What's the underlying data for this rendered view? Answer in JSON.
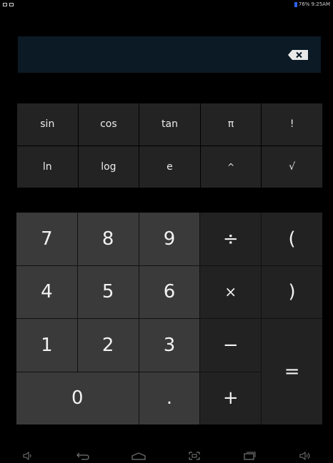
{
  "status_bar": {
    "battery": "76%",
    "time": "9:25AM",
    "colors": {
      "battery": "#2a62ff"
    }
  },
  "display": {
    "value": ""
  },
  "function_keys": [
    "sin",
    "cos",
    "tan",
    "π",
    "!",
    "ln",
    "log",
    "e",
    "^",
    "√"
  ],
  "keypad": {
    "seven": "7",
    "eight": "8",
    "nine": "9",
    "divide": "÷",
    "open_paren": "(",
    "four": "4",
    "five": "5",
    "six": "6",
    "multiply": "×",
    "close_paren": ")",
    "one": "1",
    "two": "2",
    "three": "3",
    "minus": "−",
    "equals": "=",
    "zero": "0",
    "decimal": ".",
    "plus": "+"
  },
  "nav_icons": [
    "volume-down-icon",
    "back-icon",
    "home-icon",
    "screenshot-icon",
    "recent-apps-icon",
    "volume-up-icon"
  ]
}
